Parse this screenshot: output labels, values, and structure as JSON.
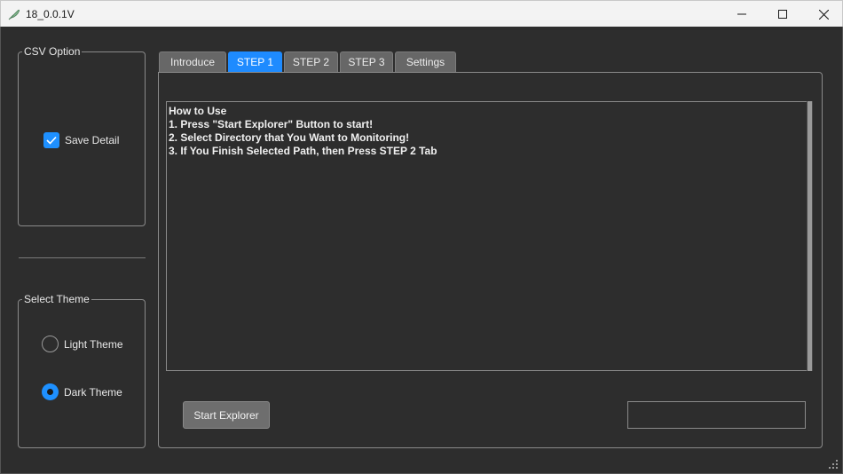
{
  "window": {
    "title": "18_0.0.1V",
    "icon": "feather-icon",
    "controls": [
      "minimize-icon",
      "maximize-icon",
      "close-icon"
    ]
  },
  "csv_option": {
    "legend": "CSV Option",
    "save_detail": {
      "label": "Save Detail",
      "checked": true
    }
  },
  "theme": {
    "legend": "Select Theme",
    "options": [
      {
        "label": "Light Theme",
        "selected": false
      },
      {
        "label": "Dark Theme",
        "selected": true
      }
    ]
  },
  "tabs": [
    {
      "label": "Introduce",
      "active": false
    },
    {
      "label": "STEP 1",
      "active": true
    },
    {
      "label": "STEP 2",
      "active": false
    },
    {
      "label": "STEP 3",
      "active": false
    },
    {
      "label": "Settings",
      "active": false
    }
  ],
  "step1": {
    "instructions": [
      "How to Use",
      "1. Press \"Start Explorer\" Button to start!",
      "2. Select Directory that You Want to Monitoring!",
      "3. If You Finish Selected Path, then Press STEP 2 Tab"
    ],
    "start_button": "Start Explorer",
    "path_value": ""
  },
  "colors": {
    "background": "#2d2d2d",
    "accent": "#1e8bff",
    "tab_inactive": "#676767"
  }
}
